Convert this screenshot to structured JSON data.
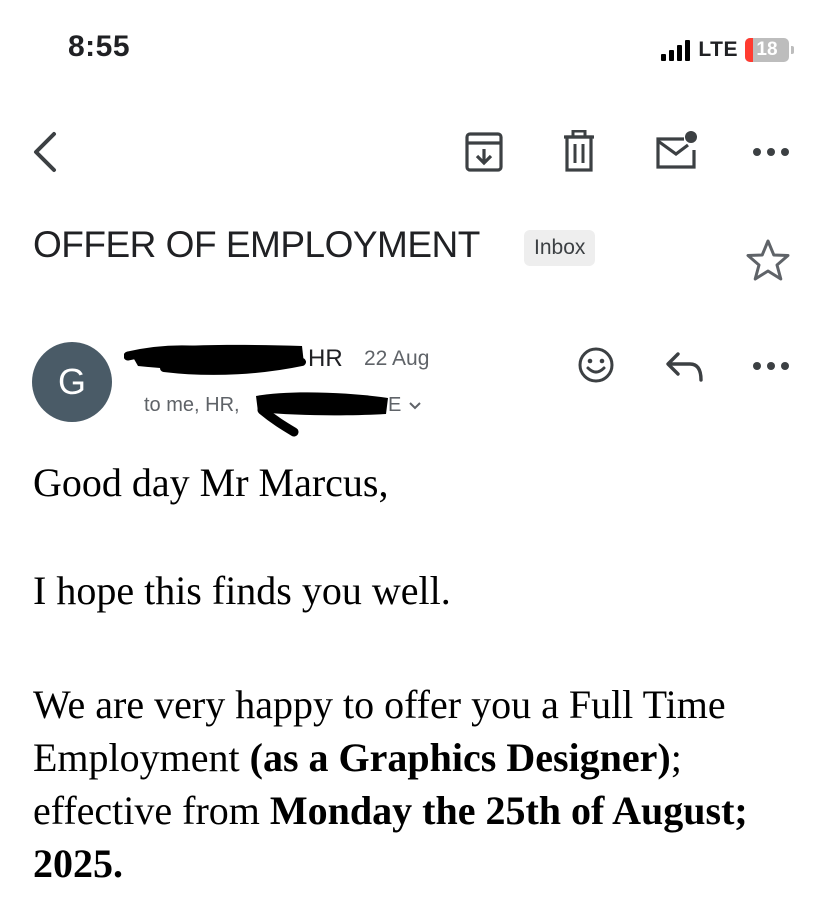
{
  "status_bar": {
    "time": "8:55",
    "network": "LTE",
    "battery": "18"
  },
  "toolbar": {
    "back_icon": "chevron-left-icon",
    "archive_icon": "archive-icon",
    "delete_icon": "trash-icon",
    "mark_unread_icon": "mail-unread-icon",
    "more_icon": "more-horizontal-icon"
  },
  "email": {
    "subject": "OFFER OF EMPLOYMENT",
    "label": "Inbox",
    "sender": {
      "avatar_letter": "G",
      "name_suffix": "HR",
      "date": "22 Aug",
      "recipients": "to me, HR,",
      "recipients_tail": "E"
    },
    "body": {
      "greeting": "Good day Mr Marcus,",
      "line2": "I hope this finds you well.",
      "p3_a": "We are very happy to offer you a Full Time Employment ",
      "p3_b": "(as a Graphics Designer)",
      "p3_c": "; effective from ",
      "p3_d": "Monday the 25th of August; 2025."
    }
  },
  "colors": {
    "avatar_bg": "#4a5b67",
    "battery_low": "#ff3b30",
    "chip_bg": "#eeeeee"
  }
}
